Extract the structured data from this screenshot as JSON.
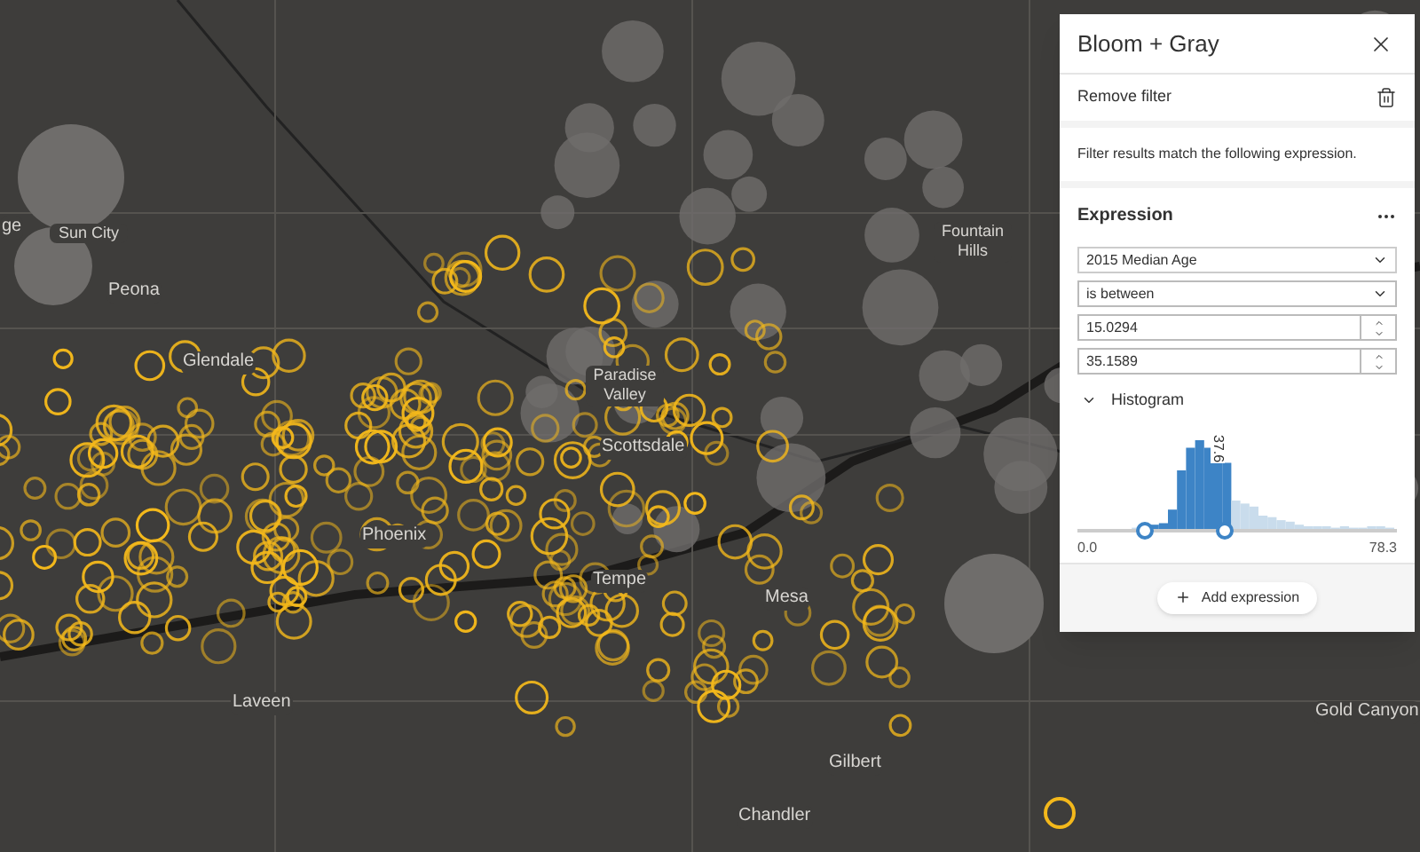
{
  "map": {
    "labels": [
      {
        "text": "ge"
      },
      {
        "text": "Sun City"
      },
      {
        "text": "Peona"
      },
      {
        "text": "Glendale"
      },
      {
        "text": "Paradise Valley"
      },
      {
        "text": "Scottsdale"
      },
      {
        "text": "Phoenix"
      },
      {
        "text": "Tempe"
      },
      {
        "text": "Mesa"
      },
      {
        "text": "Fountain Hills"
      },
      {
        "text": "Laveen"
      },
      {
        "text": "Gilbert"
      },
      {
        "text": "Chandler"
      },
      {
        "text": "Gold Canyon"
      }
    ]
  },
  "panel": {
    "title": "Bloom + Gray",
    "remove_filter": "Remove filter",
    "description": "Filter results match the following expression.",
    "expression": {
      "title": "Expression",
      "field": "2015 Median Age",
      "operator": "is between",
      "min": "15.0294",
      "max": "35.1589",
      "histogram": {
        "label": "Histogram",
        "expanded": true,
        "min_label": "0.0",
        "max_label": "78.3",
        "marker_label": "37.6",
        "handles": [
          {
            "level": 0.21
          },
          {
            "level": 0.46
          }
        ]
      }
    },
    "add_button": "Add expression"
  }
}
